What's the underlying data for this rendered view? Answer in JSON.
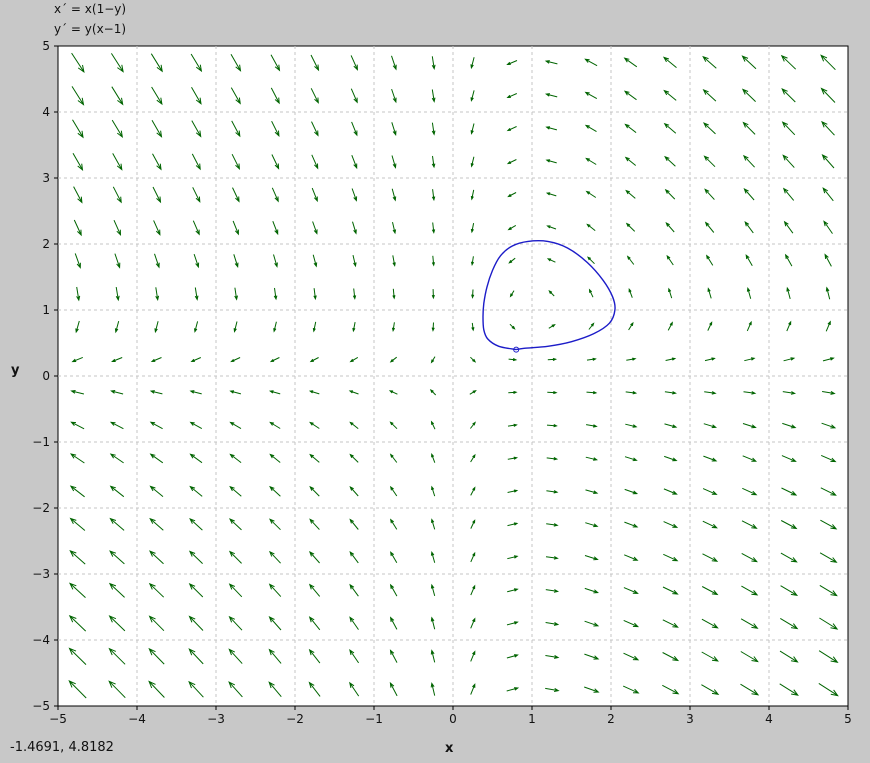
{
  "equations": {
    "xprime": "x´ = x(1−y)",
    "yprime": "y´ = y(x−1)"
  },
  "cursor_readout": "-1.4691,  4.8182",
  "chart_data": {
    "type": "vector-field",
    "title": "",
    "xlabel": "x",
    "ylabel": "y",
    "xlim": [
      -5,
      5
    ],
    "ylim": [
      -5,
      5
    ],
    "xticks": [
      -5,
      -4,
      -3,
      -2,
      -1,
      0,
      1,
      2,
      3,
      4,
      5
    ],
    "yticks": [
      -5,
      -4,
      -3,
      -2,
      -1,
      0,
      1,
      2,
      3,
      4,
      5
    ],
    "grid": true,
    "field": {
      "dx": "x*(1-y)",
      "dy": "y*(x-1)",
      "grid_x": [
        -4.75,
        -4.25,
        -3.75,
        -3.25,
        -2.75,
        -2.25,
        -1.75,
        -1.25,
        -0.75,
        -0.25,
        0.25,
        0.75,
        1.25,
        1.75,
        2.25,
        2.75,
        3.25,
        3.75,
        4.25,
        4.75
      ],
      "grid_y": [
        -4.75,
        -4.25,
        -3.75,
        -3.25,
        -2.75,
        -2.25,
        -1.75,
        -1.25,
        -0.75,
        -0.25,
        0.25,
        0.75,
        1.25,
        1.75,
        2.25,
        2.75,
        3.25,
        3.75,
        4.25,
        4.75
      ],
      "color": "#006400"
    },
    "trajectory": {
      "color": "#1c1cc8",
      "start_point": [
        0.8,
        0.4
      ],
      "points": [
        [
          0.8,
          0.4
        ],
        [
          0.58,
          0.45
        ],
        [
          0.44,
          0.56
        ],
        [
          0.39,
          0.7
        ],
        [
          0.38,
          0.9
        ],
        [
          0.39,
          1.1
        ],
        [
          0.43,
          1.35
        ],
        [
          0.5,
          1.6
        ],
        [
          0.6,
          1.82
        ],
        [
          0.75,
          1.97
        ],
        [
          0.95,
          2.04
        ],
        [
          1.2,
          2.04
        ],
        [
          1.45,
          1.94
        ],
        [
          1.7,
          1.72
        ],
        [
          1.9,
          1.45
        ],
        [
          2.02,
          1.2
        ],
        [
          2.05,
          1.0
        ],
        [
          1.98,
          0.8
        ],
        [
          1.78,
          0.64
        ],
        [
          1.5,
          0.52
        ],
        [
          1.2,
          0.45
        ],
        [
          0.9,
          0.42
        ],
        [
          0.8,
          0.4
        ]
      ]
    }
  }
}
